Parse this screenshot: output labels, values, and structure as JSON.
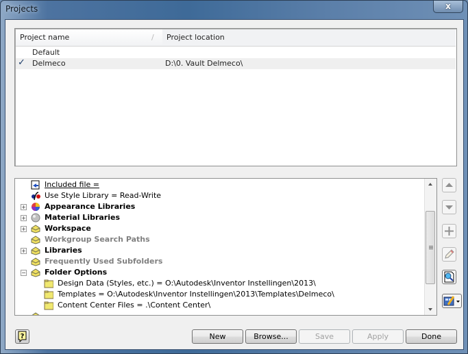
{
  "window": {
    "title": "Projects",
    "close_label": "x"
  },
  "project_list": {
    "columns": [
      "Project name",
      "Project location"
    ],
    "sort_glyph": "/",
    "rows": [
      {
        "name": "Default",
        "location": "",
        "active": false,
        "selected": false
      },
      {
        "name": "Delmeco",
        "location": "D:\\0. Vault Delmeco\\",
        "active": true,
        "selected": true
      }
    ],
    "active_mark": "✓"
  },
  "tree": {
    "items": [
      {
        "label": "Included file =",
        "icon": "included-file-icon",
        "style": "underline",
        "expander": ""
      },
      {
        "label": "Use Style Library = Read-Write",
        "icon": "style-library-icon",
        "style": "normal",
        "expander": ""
      },
      {
        "label": "Appearance Libraries",
        "icon": "appearance-library-icon",
        "style": "bold",
        "expander": "+"
      },
      {
        "label": "Material Libraries",
        "icon": "material-library-icon",
        "style": "bold",
        "expander": "+"
      },
      {
        "label": "Workspace",
        "icon": "folder-group-icon",
        "style": "bold",
        "expander": "+"
      },
      {
        "label": "Workgroup Search Paths",
        "icon": "folder-group-icon",
        "style": "gray",
        "expander": ""
      },
      {
        "label": "Libraries",
        "icon": "folder-group-icon",
        "style": "bold",
        "expander": "+"
      },
      {
        "label": "Frequently Used Subfolders",
        "icon": "folder-group-icon",
        "style": "gray",
        "expander": ""
      },
      {
        "label": "Folder Options",
        "icon": "folder-group-icon",
        "style": "bold",
        "expander": "−"
      },
      {
        "label": "Design Data (Styles, etc.) = O:\\Autodesk\\Inventor Instellingen\\2013\\",
        "icon": "folder-icon",
        "style": "child",
        "expander": ""
      },
      {
        "label": "Templates = O:\\Autodesk\\Inventor Instellingen\\2013\\Templates\\Delmeco\\",
        "icon": "folder-icon",
        "style": "child",
        "expander": ""
      },
      {
        "label": "Content Center Files = .\\Content Center\\",
        "icon": "folder-icon",
        "style": "child",
        "expander": ""
      }
    ]
  },
  "side_buttons": [
    "move-up",
    "move-down",
    "add-path",
    "edit",
    "find-path",
    "options-menu"
  ],
  "buttons": {
    "new": "New",
    "browse": "Browse...",
    "save": "Save",
    "apply": "Apply",
    "done": "Done"
  }
}
